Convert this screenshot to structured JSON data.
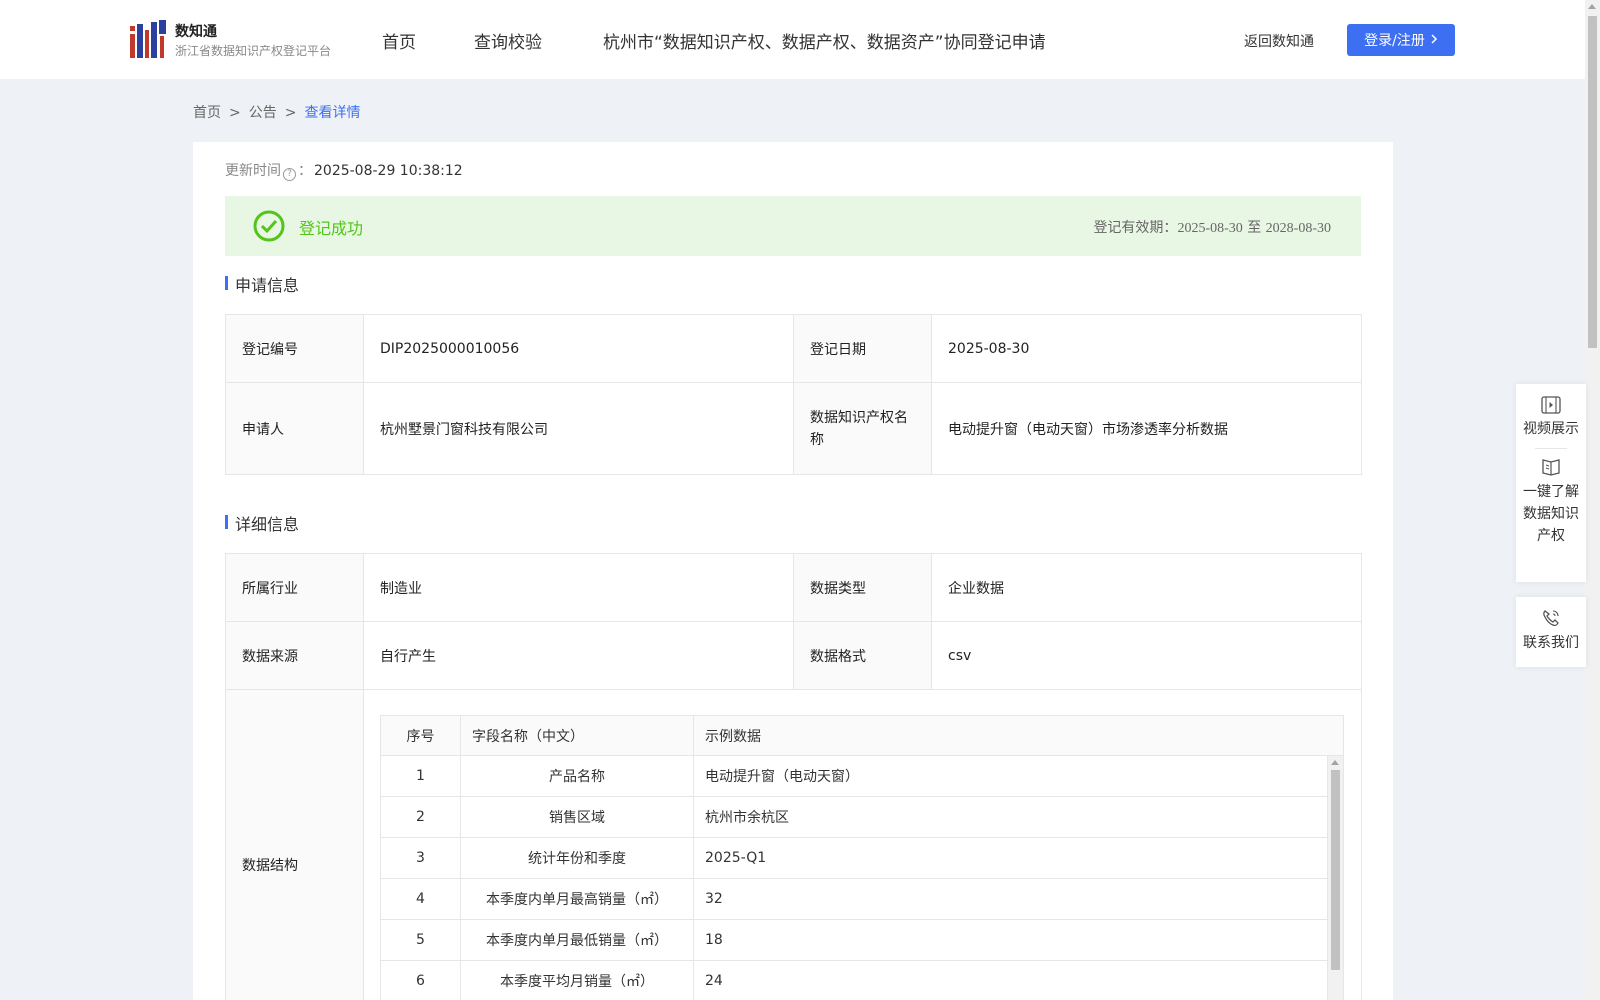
{
  "brand": {
    "title": "数知通",
    "subtitle": "浙江省数据知识产权登记平台"
  },
  "nav": {
    "items": [
      "首页",
      "查询校验",
      "杭州市“数据知识产权、数据产权、数据资产”协同登记申请"
    ],
    "back_link": "返回数知通",
    "login_button": "登录/注册"
  },
  "breadcrumb": {
    "home": "首页",
    "notice": "公告",
    "current": "查看详情",
    "separator": ">"
  },
  "update": {
    "label": "更新时间",
    "suffix": "：",
    "value": "2025-08-29 10:38:12"
  },
  "status": {
    "label": "登记成功",
    "validity_label": "登记有效期：",
    "validity_from": "2025-08-30",
    "validity_to_word": "至",
    "validity_to": "2028-08-30"
  },
  "application_info": {
    "title": "申请信息",
    "reg_no_label": "登记编号",
    "reg_no": "DIP2025000010056",
    "reg_date_label": "登记日期",
    "reg_date": "2025-08-30",
    "applicant_label": "申请人",
    "applicant": "杭州墅景门窗科技有限公司",
    "ip_name_label": "数据知识产权名称",
    "ip_name": "电动提升窗（电动天窗）市场渗透率分析数据"
  },
  "detail_info": {
    "title": "详细信息",
    "industry_label": "所属行业",
    "industry": "制造业",
    "data_type_label": "数据类型",
    "data_type": "企业数据",
    "source_label": "数据来源",
    "source": "自行产生",
    "format_label": "数据格式",
    "format": "csv",
    "structure_label": "数据结构"
  },
  "structure_table": {
    "headers": [
      "序号",
      "字段名称（中文）",
      "示例数据"
    ],
    "rows": [
      [
        "1",
        "产品名称",
        "电动提升窗（电动天窗）"
      ],
      [
        "2",
        "销售区域",
        "杭州市余杭区"
      ],
      [
        "3",
        "统计年份和季度",
        "2025-Q1"
      ],
      [
        "4",
        "本季度内单月最高销量（㎡）",
        "32"
      ],
      [
        "5",
        "本季度内单月最低销量（㎡）",
        "18"
      ],
      [
        "6",
        "本季度平均月销量（㎡）",
        "24"
      ]
    ]
  },
  "side_panel": {
    "video": "视频展示",
    "learn": "一键了解数据知识产权",
    "contact": "联系我们"
  },
  "colors": {
    "accent": "#3d6ff3",
    "success": "#52c41a",
    "success_bg": "#e8f7e4"
  }
}
